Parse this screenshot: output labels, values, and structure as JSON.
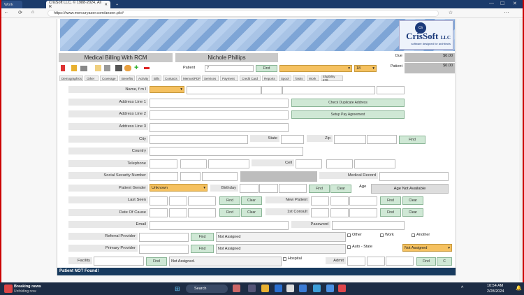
{
  "browser": {
    "profile_tab": "Work",
    "tab_title": "CrisSoft LLC, © 1988-2024, All R",
    "url": "https://www.mercuryaser.com/ansen.plc#",
    "new_tab": "+"
  },
  "banner": {
    "logo_name": "CrisSoft",
    "logo_suffix": "LLC",
    "logo_tagline": "software designed for architects"
  },
  "header": {
    "app_title": "Medical Billing With RCM",
    "patient_name": "Nichole Phillips",
    "due_label": "Due",
    "due_value": "$0.00",
    "patient_label": "Patient",
    "patient_value": "$0.00",
    "patient_search_label": "Patient",
    "patient_search_value": "7",
    "find_label": "Find",
    "count_value": "18"
  },
  "tabs": [
    "Demographics",
    "Other",
    "Coverage",
    "Benefits",
    "Activity",
    "Bills",
    "Contacts",
    "Memos/PDF",
    "Services",
    "Payment",
    "Credit Card",
    "Reports",
    "Spool",
    "Tasks",
    "Work",
    "Eligibility 270"
  ],
  "form": {
    "name_label": "Name, f m l",
    "addr1_label": "Address Line 1",
    "check_dup": "Check Duplicate Address",
    "addr2_label": "Address Line 2",
    "setup_pay": "Setup Pay Agreement",
    "addr3_label": "Address Line 3",
    "city_label": "City",
    "state_label": "State",
    "zip_label": "Zip",
    "find": "Find",
    "country_label": "Country",
    "telephone_label": "Telephone",
    "cell_label": "Cell",
    "ssn_label": "Social Security Number",
    "medical_record_label": "Medical Record",
    "gender_label": "Patient Gender",
    "gender_value": "Unknown",
    "birthday_label": "Birthday",
    "clear": "Clear",
    "age_label": "Age",
    "age_value": "Age Not Available",
    "last_seen_label": "Last Seen",
    "new_patient_label": "New Patient",
    "date_cause_label": "Date Of Cause",
    "first_consult_label": "1st Consult",
    "email_label": "Email",
    "password_label": "Password",
    "referral_label": "Referral Provider",
    "not_assigned": "Not Assigned",
    "other_label": "Other",
    "work_label": "Work",
    "another_label": "Another",
    "primary_label": "Primary Provider",
    "auto_state_label": "Auto - State",
    "not_assigned_dd": "Not Assigned",
    "facility_label": "Facility",
    "facility_value": "Not Assigned.",
    "hospital_label": "Hospital",
    "admit_label": "Admit",
    "c_label": "C",
    "status": "Patient NOT Found!"
  },
  "taskbar": {
    "news_title": "Breaking news",
    "news_sub": "Unfolding now",
    "search": "Search",
    "time": "10:54 AM",
    "date": "2/28/2024"
  }
}
